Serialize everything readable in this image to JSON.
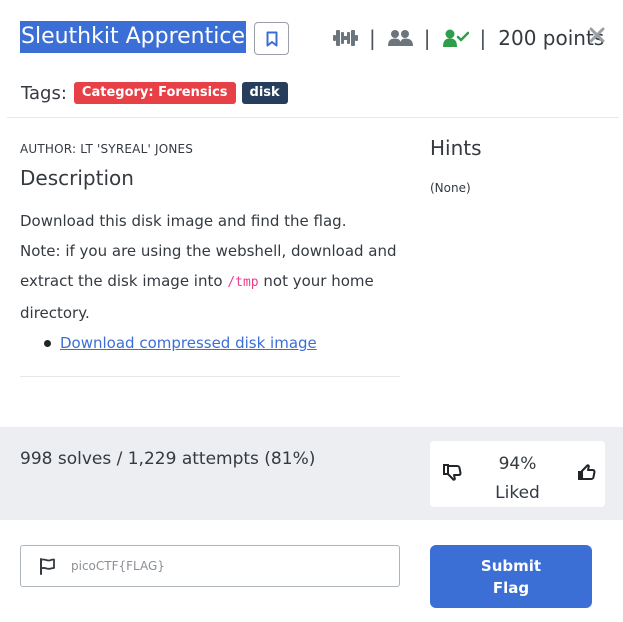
{
  "header": {
    "title": "Sleuthkit Apprentice",
    "separator": "|",
    "points": "200 points"
  },
  "icons": {
    "bookmark": "bookmark-icon",
    "difficulty": "dumbbell-icon",
    "users": "users-icon",
    "solved": "user-check-icon",
    "close": "close-icon"
  },
  "colors": {
    "accent": "#3b6fd6",
    "solved_green": "#2e9e4b",
    "badge_red": "#e74147",
    "badge_dark": "#263e5c"
  },
  "tags": {
    "label": "Tags:",
    "items": [
      "Category: Forensics",
      "disk"
    ]
  },
  "description": {
    "author": "AUTHOR: LT 'SYREAL' JONES",
    "heading": "Description",
    "line1": "Download this disk image and find the flag.",
    "line2_pre": "Note: if you are using the webshell, download and extract the disk image into ",
    "code": "/tmp",
    "line2_post": " not your home directory.",
    "link": "Download compressed disk image"
  },
  "hints": {
    "heading": "Hints",
    "value": "(None)"
  },
  "stats": {
    "solves": "998 solves / 1,229 attempts (81%)",
    "liked_pct": "94%",
    "liked_label": "Liked"
  },
  "submit": {
    "placeholder": "picoCTF{FLAG}",
    "button_line1": "Submit",
    "button_line2": "Flag"
  }
}
